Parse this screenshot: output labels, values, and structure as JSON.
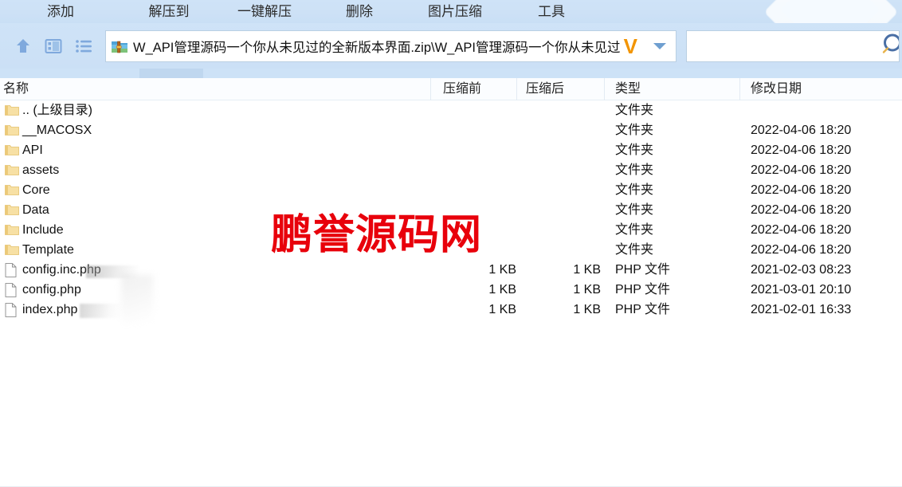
{
  "toolbar": {
    "items": [
      {
        "label": "添加",
        "icon": "add-icon"
      },
      {
        "label": "解压到",
        "icon": "extract-to-icon"
      },
      {
        "label": "一键解压",
        "icon": "one-click-extract-icon"
      },
      {
        "label": "删除",
        "icon": "delete-icon"
      },
      {
        "label": "图片压缩",
        "icon": "image-compress-icon"
      },
      {
        "label": "工具",
        "icon": "tools-icon"
      }
    ]
  },
  "nav": {
    "up_icon": "up-arrow-icon",
    "panel_icon": "panel-view-icon",
    "list_icon": "list-view-icon"
  },
  "address": {
    "icon": "zip-archive-icon",
    "path": "W_API管理源码一个你从未见过的全新版本界面.zip\\W_API管理源码一个你从未见过",
    "brand_mark": "V",
    "dropdown_icon": "chevron-down-icon"
  },
  "search": {
    "value": "",
    "placeholder": "",
    "icon": "search-icon"
  },
  "columns": [
    {
      "key": "name",
      "label": "名称"
    },
    {
      "key": "size_before",
      "label": "压缩前"
    },
    {
      "key": "size_after",
      "label": "压缩后"
    },
    {
      "key": "type",
      "label": "类型"
    },
    {
      "key": "modified",
      "label": "修改日期"
    }
  ],
  "files": [
    {
      "icon": "folder-icon",
      "name": ".. (上级目录)",
      "size_before": "",
      "size_after": "",
      "type": "文件夹",
      "modified": ""
    },
    {
      "icon": "folder-icon",
      "name": "__MACOSX",
      "size_before": "",
      "size_after": "",
      "type": "文件夹",
      "modified": "2022-04-06 18:20"
    },
    {
      "icon": "folder-icon",
      "name": "API",
      "size_before": "",
      "size_after": "",
      "type": "文件夹",
      "modified": "2022-04-06 18:20"
    },
    {
      "icon": "folder-icon",
      "name": "assets",
      "size_before": "",
      "size_after": "",
      "type": "文件夹",
      "modified": "2022-04-06 18:20"
    },
    {
      "icon": "folder-icon",
      "name": "Core",
      "size_before": "",
      "size_after": "",
      "type": "文件夹",
      "modified": "2022-04-06 18:20"
    },
    {
      "icon": "folder-icon",
      "name": "Data",
      "size_before": "",
      "size_after": "",
      "type": "文件夹",
      "modified": "2022-04-06 18:20"
    },
    {
      "icon": "folder-icon",
      "name": "Include",
      "size_before": "",
      "size_after": "",
      "type": "文件夹",
      "modified": "2022-04-06 18:20"
    },
    {
      "icon": "folder-icon",
      "name": "Template",
      "size_before": "",
      "size_after": "",
      "type": "文件夹",
      "modified": "2022-04-06 18:20"
    },
    {
      "icon": "file-icon",
      "name": "config.inc.php",
      "size_before": "1 KB",
      "size_after": "1 KB",
      "type": "PHP 文件",
      "modified": "2021-02-03 08:23"
    },
    {
      "icon": "file-icon",
      "name": "config.php",
      "size_before": "1 KB",
      "size_after": "1 KB",
      "type": "PHP 文件",
      "modified": "2021-03-01 20:10"
    },
    {
      "icon": "file-icon",
      "name": "index.php",
      "size_before": "1 KB",
      "size_after": "1 KB",
      "type": "PHP 文件",
      "modified": "2021-02-01 16:33"
    }
  ],
  "watermark": {
    "text": "鹏誉源码网",
    "color": "#e8000b"
  },
  "colors": {
    "toolbar_bg": "#cfe3f7",
    "accent_blue": "#6f9fd0",
    "folder_yellow": "#f3d486",
    "brand_orange": "#f29400",
    "watermark_red": "#e8000b"
  }
}
